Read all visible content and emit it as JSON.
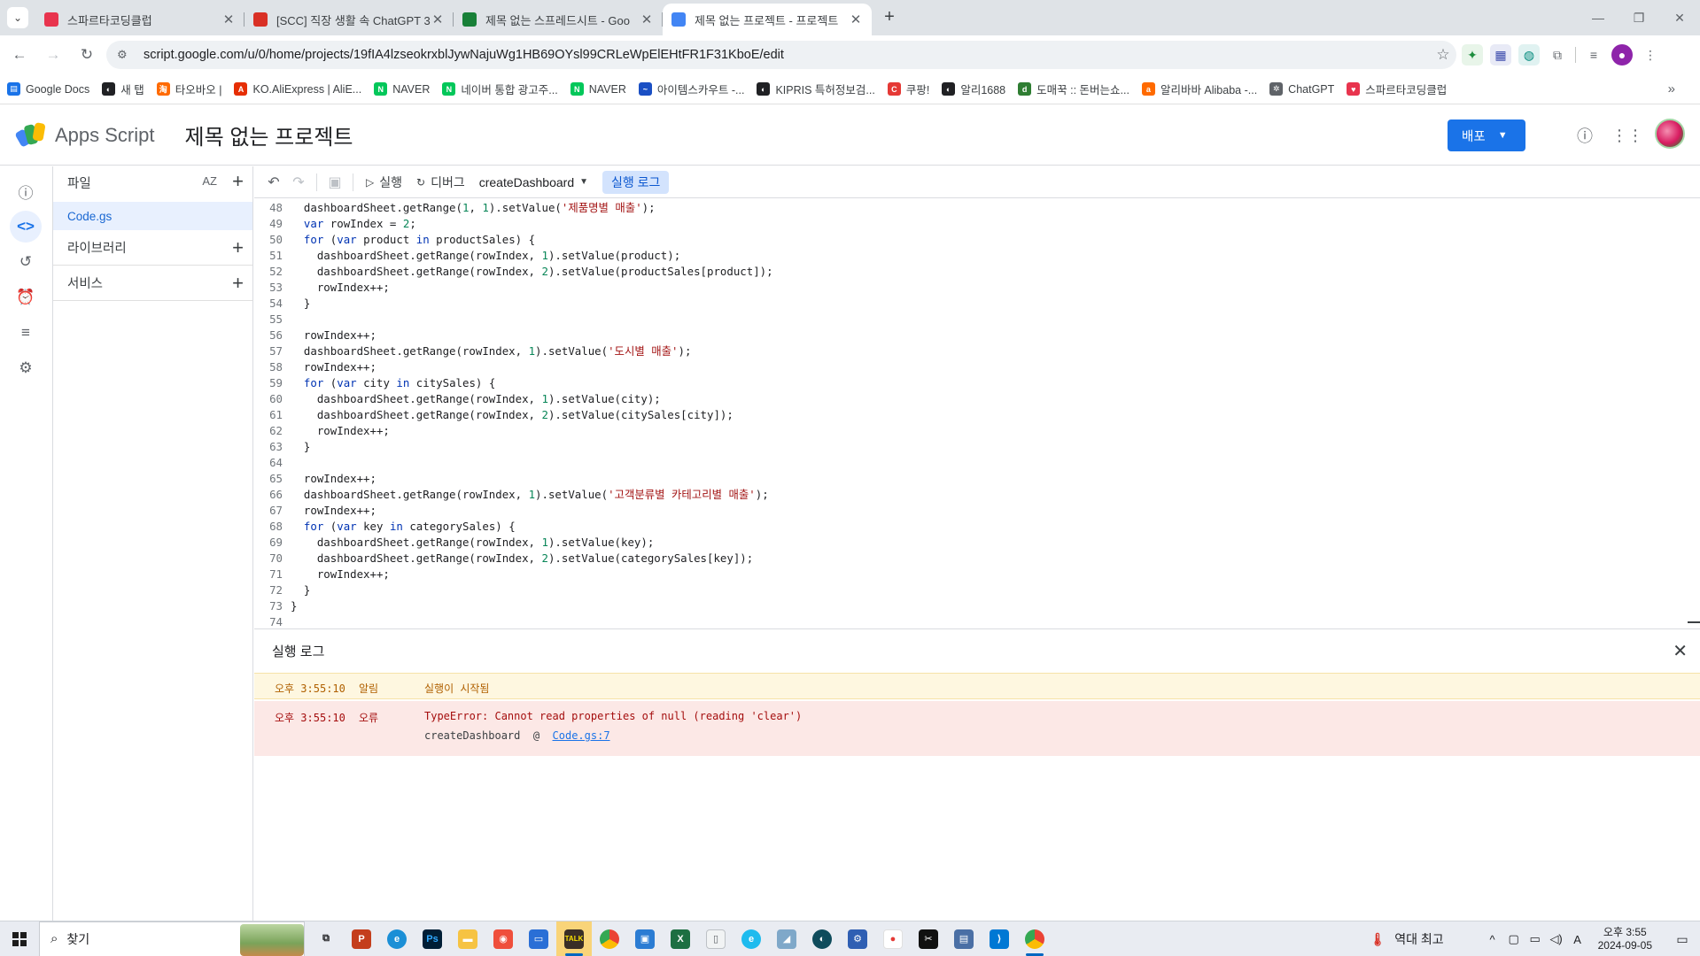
{
  "browser": {
    "tabs": [
      {
        "title": "스파르타코딩클럽",
        "active": false,
        "favicon_color": "#e8344e"
      },
      {
        "title": "[SCC] 직장 생활 속 ChatGPT 3(",
        "active": false,
        "favicon_color": "#d93025"
      },
      {
        "title": "제목 없는 스프레드시트 - Goo",
        "active": false,
        "favicon_color": "#188038"
      },
      {
        "title": "제목 없는 프로젝트 - 프로젝트",
        "active": true,
        "favicon_color": "#4285f4"
      }
    ],
    "url": "script.google.com/u/0/home/projects/19fIA4lzseokrxblJywNajuWg1HB69OYsl99CRLeWpElEHtFR1F31KboE/edit",
    "bookmarks": [
      {
        "label": "Google Docs",
        "color": "#1a73e8",
        "glyph": "▤"
      },
      {
        "label": "새 탭",
        "color": "#202124",
        "glyph": "◐"
      },
      {
        "label": "타오바오 |",
        "color": "#ff6a00",
        "glyph": "淘"
      },
      {
        "label": "KO.AliExpress | AliE...",
        "color": "#e62e04",
        "glyph": "A"
      },
      {
        "label": "NAVER",
        "color": "#03c75a",
        "glyph": "N"
      },
      {
        "label": "네이버 통합 광고주...",
        "color": "#03c75a",
        "glyph": "N"
      },
      {
        "label": "NAVER",
        "color": "#03c75a",
        "glyph": "N"
      },
      {
        "label": "아이템스카우트 -...",
        "color": "#1a4fc4",
        "glyph": "~"
      },
      {
        "label": "KIPRIS 특허정보검...",
        "color": "#202124",
        "glyph": "◐"
      },
      {
        "label": "쿠팡!",
        "color": "#e53935",
        "glyph": "C"
      },
      {
        "label": "알리1688",
        "color": "#202124",
        "glyph": "◐"
      },
      {
        "label": "도매꾹 :: 돈버는쇼...",
        "color": "#2e7d32",
        "glyph": "d"
      },
      {
        "label": "알리바바 Alibaba -...",
        "color": "#ff6a00",
        "glyph": "a"
      },
      {
        "label": "ChatGPT",
        "color": "#5f6368",
        "glyph": "✲"
      },
      {
        "label": "스파르타코딩클럽",
        "color": "#e8344e",
        "glyph": "♥"
      }
    ]
  },
  "header": {
    "brand": "Apps Script",
    "project_title": "제목 없는 프로젝트",
    "deploy_label": "배포"
  },
  "files": {
    "heading": "파일",
    "sort_label": "AZ",
    "items": [
      {
        "name": "Code.gs"
      }
    ],
    "sections": [
      {
        "label": "라이브러리"
      },
      {
        "label": "서비스"
      }
    ]
  },
  "toolbar": {
    "run_label": "실행",
    "debug_label": "디버그",
    "function_name": "createDashboard",
    "log_label": "실행 로그"
  },
  "code_lines": [
    {
      "n": "48",
      "html": "dashboardSheet.getRange(<span class=\"num\">1</span>, <span class=\"num\">1</span>).setValue(<span class=\"str\">'제품명별 매출'</span>);",
      "indent": 1
    },
    {
      "n": "49",
      "html": "<span class=\"kw\">var</span> rowIndex = <span class=\"num\">2</span>;",
      "indent": 1
    },
    {
      "n": "50",
      "html": "<span class=\"kw\">for</span> (<span class=\"kw\">var</span> product <span class=\"kw\">in</span> productSales) {",
      "indent": 1
    },
    {
      "n": "51",
      "html": "dashboardSheet.getRange(rowIndex, <span class=\"num\">1</span>).setValue(product);",
      "indent": 2
    },
    {
      "n": "52",
      "html": "dashboardSheet.getRange(rowIndex, <span class=\"num\">2</span>).setValue(productSales[product]);",
      "indent": 2
    },
    {
      "n": "53",
      "html": "rowIndex++;",
      "indent": 2
    },
    {
      "n": "54",
      "html": "}",
      "indent": 1
    },
    {
      "n": "55",
      "html": "",
      "indent": 0
    },
    {
      "n": "56",
      "html": "rowIndex++;",
      "indent": 1
    },
    {
      "n": "57",
      "html": "dashboardSheet.getRange(rowIndex, <span class=\"num\">1</span>).setValue(<span class=\"str\">'도시별 매출'</span>);",
      "indent": 1
    },
    {
      "n": "58",
      "html": "rowIndex++;",
      "indent": 1
    },
    {
      "n": "59",
      "html": "<span class=\"kw\">for</span> (<span class=\"kw\">var</span> city <span class=\"kw\">in</span> citySales) {",
      "indent": 1
    },
    {
      "n": "60",
      "html": "dashboardSheet.getRange(rowIndex, <span class=\"num\">1</span>).setValue(city);",
      "indent": 2
    },
    {
      "n": "61",
      "html": "dashboardSheet.getRange(rowIndex, <span class=\"num\">2</span>).setValue(citySales[city]);",
      "indent": 2
    },
    {
      "n": "62",
      "html": "rowIndex++;",
      "indent": 2
    },
    {
      "n": "63",
      "html": "}",
      "indent": 1
    },
    {
      "n": "64",
      "html": "",
      "indent": 0
    },
    {
      "n": "65",
      "html": "rowIndex++;",
      "indent": 1
    },
    {
      "n": "66",
      "html": "dashboardSheet.getRange(rowIndex, <span class=\"num\">1</span>).setValue(<span class=\"str\">'고객분류별 카테고리별 매출'</span>);",
      "indent": 1
    },
    {
      "n": "67",
      "html": "rowIndex++;",
      "indent": 1
    },
    {
      "n": "68",
      "html": "<span class=\"kw\">for</span> (<span class=\"kw\">var</span> key <span class=\"kw\">in</span> categorySales) {",
      "indent": 1
    },
    {
      "n": "69",
      "html": "dashboardSheet.getRange(rowIndex, <span class=\"num\">1</span>).setValue(key);",
      "indent": 2
    },
    {
      "n": "70",
      "html": "dashboardSheet.getRange(rowIndex, <span class=\"num\">2</span>).setValue(categorySales[key]);",
      "indent": 2
    },
    {
      "n": "71",
      "html": "rowIndex++;",
      "indent": 2
    },
    {
      "n": "72",
      "html": "}",
      "indent": 1
    },
    {
      "n": "73",
      "html": "}",
      "indent": 0
    },
    {
      "n": "74",
      "html": "",
      "indent": 0
    }
  ],
  "log": {
    "title": "실행 로그",
    "entries": [
      {
        "time": "오후 3:55:10",
        "level": "알림",
        "message": "실행이 시작됨"
      },
      {
        "time": "오후 3:55:10",
        "level": "오류",
        "message": "TypeError: Cannot read properties of null (reading 'clear')",
        "stack_fn": "createDashboard",
        "stack_at": "@",
        "stack_link": "Code.gs:7"
      }
    ]
  },
  "taskbar": {
    "search_placeholder": "찾기",
    "weather": "역대 최고",
    "time": "오후 3:55",
    "date": "2024-09-05",
    "ime": "A"
  }
}
